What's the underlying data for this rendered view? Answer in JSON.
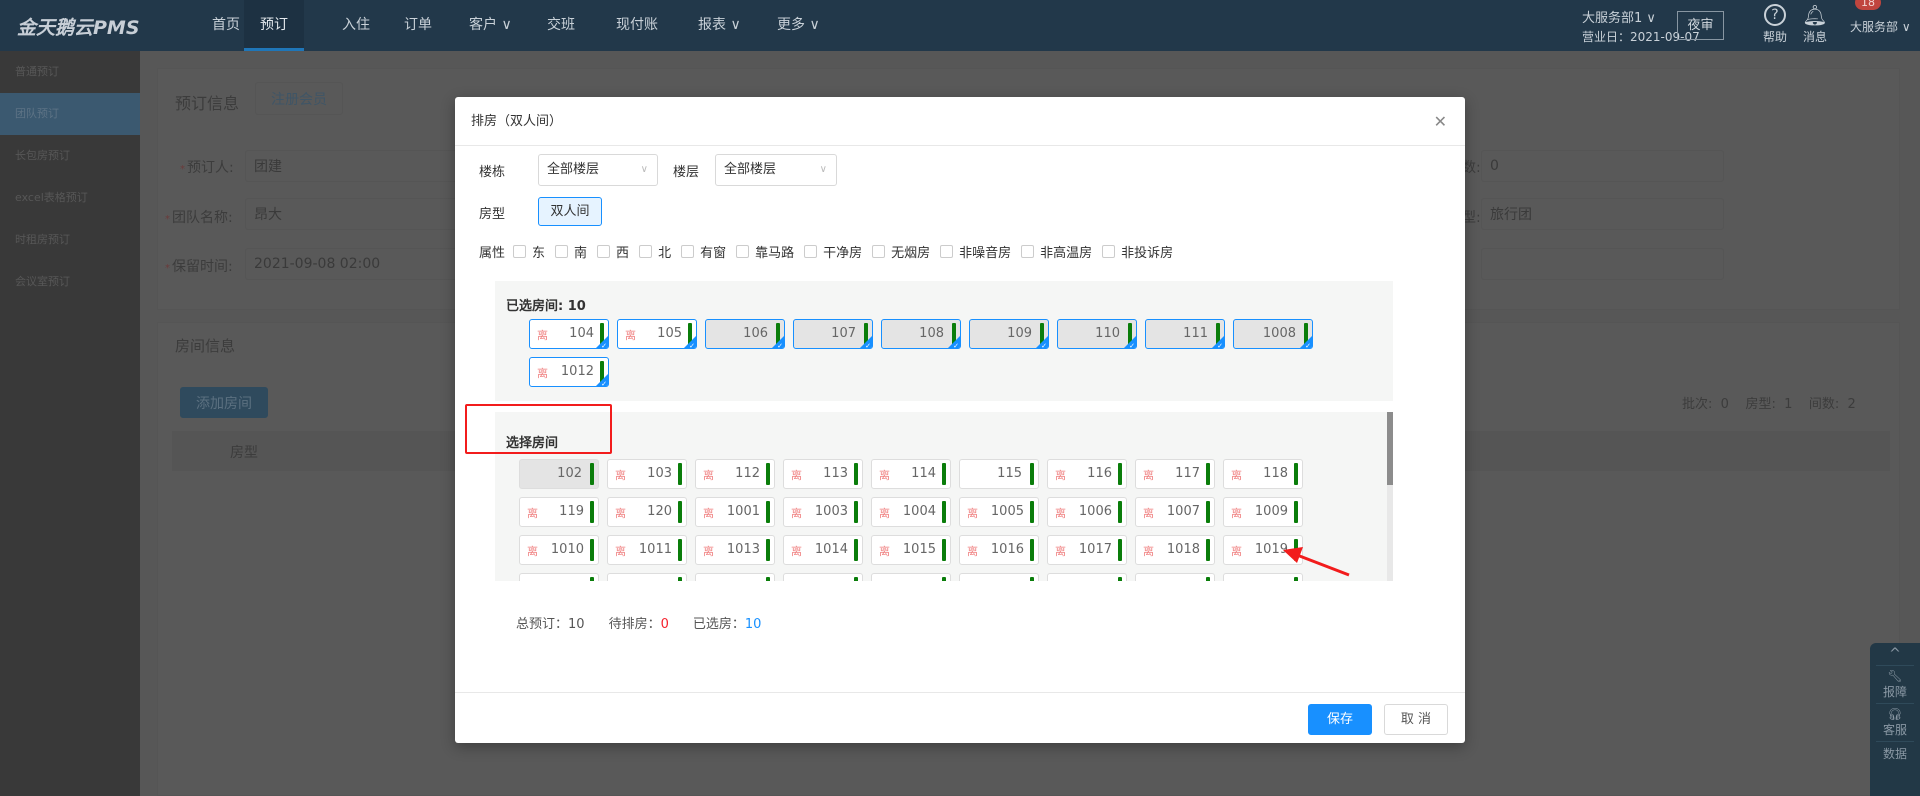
{
  "nav": {
    "logo": "金天鹅云PMS",
    "items": [
      {
        "label": "首页"
      },
      {
        "label": "预订",
        "active": true
      },
      {
        "label": "入住"
      },
      {
        "label": "订单"
      },
      {
        "label": "客户 ∨"
      },
      {
        "label": "交班"
      },
      {
        "label": "现付账"
      },
      {
        "label": "报表 ∨"
      },
      {
        "label": "更多 ∨"
      }
    ],
    "department": "大服务部1 ∨",
    "business_date": "营业日：2021-09-07",
    "night_audit": "夜审",
    "help": "帮助",
    "messages": "消息",
    "message_count": "18",
    "user": "大服务部 ∨"
  },
  "sidebar": {
    "items": [
      {
        "label": "普通预订"
      },
      {
        "label": "团队预订",
        "active": true
      },
      {
        "label": "长包房预订"
      },
      {
        "label": "excel表格预订"
      },
      {
        "label": "时租房预订"
      },
      {
        "label": "会议室预订"
      }
    ]
  },
  "page": {
    "booking_info": "预订信息",
    "register_member": "注册会员",
    "booker_label": "预订人:",
    "booker_value": "团建",
    "group_name_label": "团队名称:",
    "group_name_value": "昂大",
    "hold_time_label": "保留时间:",
    "hold_time_value": "2021-09-08 02:00",
    "right_label_1": "数:",
    "right_value_1": "0",
    "right_label_2": "型:",
    "right_value_2": "旅行团",
    "room_info": "房间信息",
    "add_room": "添加房间",
    "stats": "批次:  0    房型:  1    间数:  2",
    "table_header_room_type": "房型"
  },
  "float_bar": {
    "report": "报障",
    "service": "客服",
    "data": "数据"
  },
  "dialog": {
    "title": "排房（双人间）",
    "building_label": "楼栋",
    "building_value": "全部楼层",
    "floor_label": "楼层",
    "floor_value": "全部楼层",
    "room_type_label": "房型",
    "room_type_value": "双人间",
    "attr_label": "属性",
    "attributes": [
      "东",
      "南",
      "西",
      "北",
      "有窗",
      "靠马路",
      "干净房",
      "无烟房",
      "非噪音房",
      "非高温房",
      "非投诉房"
    ],
    "selected_title": "已选房间: 10",
    "selected_rooms": [
      {
        "no": "104",
        "tag": "离"
      },
      {
        "no": "105",
        "tag": "离"
      },
      {
        "no": "106",
        "grey": true
      },
      {
        "no": "107",
        "grey": true
      },
      {
        "no": "108",
        "grey": true
      },
      {
        "no": "109",
        "grey": true
      },
      {
        "no": "110",
        "grey": true
      },
      {
        "no": "111",
        "grey": true
      },
      {
        "no": "1008",
        "grey": true
      },
      {
        "no": "1012",
        "tag": "离"
      }
    ],
    "choose_title": "选择房间",
    "available_rooms": [
      {
        "no": "102",
        "grey": true
      },
      {
        "no": "103",
        "tag": "离"
      },
      {
        "no": "112",
        "tag": "离"
      },
      {
        "no": "113",
        "tag": "离"
      },
      {
        "no": "114",
        "tag": "离"
      },
      {
        "no": "115"
      },
      {
        "no": "116",
        "tag": "离"
      },
      {
        "no": "117",
        "tag": "离"
      },
      {
        "no": "118",
        "tag": "离"
      },
      {
        "no": "119",
        "tag": "离"
      },
      {
        "no": "120",
        "tag": "离"
      },
      {
        "no": "1001",
        "tag": "离"
      },
      {
        "no": "1003",
        "tag": "离"
      },
      {
        "no": "1004",
        "tag": "离"
      },
      {
        "no": "1005",
        "tag": "离"
      },
      {
        "no": "1006",
        "tag": "离"
      },
      {
        "no": "1007",
        "tag": "离"
      },
      {
        "no": "1009",
        "tag": "离"
      },
      {
        "no": "1010",
        "tag": "离"
      },
      {
        "no": "1011",
        "tag": "离"
      },
      {
        "no": "1013",
        "tag": "离"
      },
      {
        "no": "1014",
        "tag": "离"
      },
      {
        "no": "1015",
        "tag": "离"
      },
      {
        "no": "1016",
        "tag": "离"
      },
      {
        "no": "1017",
        "tag": "离"
      },
      {
        "no": "1018",
        "tag": "离"
      },
      {
        "no": "1019",
        "tag": "离"
      }
    ],
    "total_label": "总预订：",
    "total_value": "10",
    "pending_label": "待排房：",
    "pending_value": "0",
    "chosen_label": "已选房：",
    "chosen_value": "10",
    "save": "保存",
    "cancel": "取 消"
  },
  "colors": {
    "nav": "#22384a",
    "primary": "#1890ff",
    "room_status_bar": "#0a7d0a",
    "pending": "#f5222d",
    "annotation": "#f21c1c"
  }
}
